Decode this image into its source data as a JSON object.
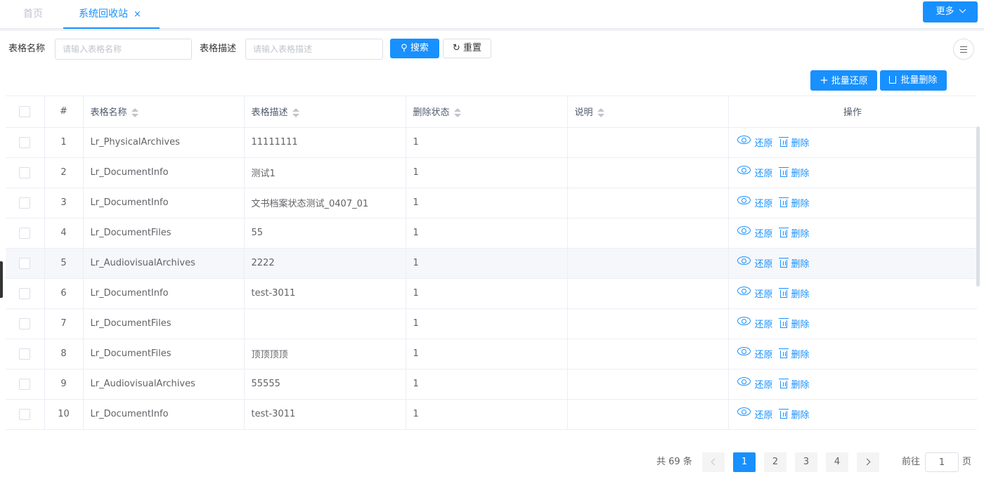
{
  "tabs": {
    "home": "首页",
    "active": "系统回收站",
    "close": "×"
  },
  "more_label": "更多",
  "search": {
    "name_label": "表格名称",
    "name_placeholder": "请输入表格名称",
    "desc_label": "表格描述",
    "desc_placeholder": "请输入表格描述",
    "search_btn": "搜索",
    "reset_btn": "重置"
  },
  "actions": {
    "batch_restore": "批量还原",
    "batch_delete": "批量删除",
    "restore": "还原",
    "delete": "删除"
  },
  "table": {
    "headers": {
      "index": "#",
      "name": "表格名称",
      "desc": "表格描述",
      "status": "删除状态",
      "note": "说明",
      "ops": "操作"
    },
    "rows": [
      {
        "index": "1",
        "name": "Lr_PhysicalArchives",
        "desc": "11111111",
        "status": "1",
        "note": ""
      },
      {
        "index": "2",
        "name": "Lr_DocumentInfo",
        "desc": "测试1",
        "status": "1",
        "note": ""
      },
      {
        "index": "3",
        "name": "Lr_DocumentInfo",
        "desc": "文书档案状态测试_0407_01",
        "status": "1",
        "note": ""
      },
      {
        "index": "4",
        "name": "Lr_DocumentFiles",
        "desc": "55",
        "status": "1",
        "note": ""
      },
      {
        "index": "5",
        "name": "Lr_AudiovisualArchives",
        "desc": "2222",
        "status": "1",
        "note": ""
      },
      {
        "index": "6",
        "name": "Lr_DocumentInfo",
        "desc": "test-3011",
        "status": "1",
        "note": ""
      },
      {
        "index": "7",
        "name": "Lr_DocumentFiles",
        "desc": "",
        "status": "1",
        "note": ""
      },
      {
        "index": "8",
        "name": "Lr_DocumentFiles",
        "desc": "顶顶顶顶",
        "status": "1",
        "note": ""
      },
      {
        "index": "9",
        "name": "Lr_AudiovisualArchives",
        "desc": "55555",
        "status": "1",
        "note": ""
      },
      {
        "index": "10",
        "name": "Lr_DocumentInfo",
        "desc": "test-3011",
        "status": "1",
        "note": ""
      }
    ],
    "hover_row": 4
  },
  "pagination": {
    "total": "共 69 条",
    "pages": [
      "1",
      "2",
      "3",
      "4"
    ],
    "current": "1",
    "goto_label": "前往",
    "goto_value": "1",
    "page_suffix": "页"
  },
  "colors": {
    "primary": "#1890ff",
    "border": "#ebeef5",
    "text": "#606266"
  }
}
